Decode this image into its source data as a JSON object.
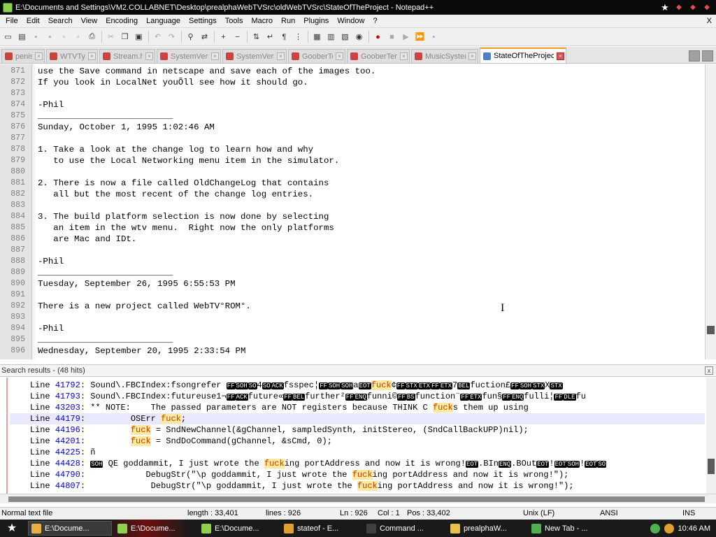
{
  "window": {
    "title": "E:\\Documents and Settings\\VM2.COLLABNET\\Desktop\\prealphaWebTVSrc\\oldWebTVSrc\\StateOfTheProject - Notepad++"
  },
  "menu": [
    "File",
    "Edit",
    "Search",
    "View",
    "Encoding",
    "Language",
    "Settings",
    "Tools",
    "Macro",
    "Run",
    "Plugins",
    "Window",
    "?"
  ],
  "menu_close": "X",
  "tabs": [
    {
      "label": "penis",
      "active": false
    },
    {
      "label": "WTVTypes.h",
      "active": false
    },
    {
      "label": "Stream.h",
      "active": false
    },
    {
      "label": "SystemVersion.h",
      "active": false
    },
    {
      "label": "SystemVersion.c",
      "active": false
    },
    {
      "label": "GooberTerm",
      "active": false
    },
    {
      "label": "GooberTerm",
      "active": false
    },
    {
      "label": "MusicSystem.c",
      "active": false
    },
    {
      "label": "StateOfTheProject",
      "active": true
    }
  ],
  "editor": {
    "lines": [
      {
        "n": "871",
        "t": "use the Save command in netscape and save each of the images too."
      },
      {
        "n": "872",
        "t": "If you look in LocalNet youÕll see how it should go."
      },
      {
        "n": "873",
        "t": ""
      },
      {
        "n": "874",
        "t": "-Phil"
      },
      {
        "n": "875",
        "t": "__________________________"
      },
      {
        "n": "876",
        "t": "Sunday, October 1, 1995 1:02:46 AM"
      },
      {
        "n": "877",
        "t": ""
      },
      {
        "n": "878",
        "t": "1. Take a look at the change log to learn how and why"
      },
      {
        "n": "879",
        "t": "   to use the Local Networking menu item in the simulator."
      },
      {
        "n": "880",
        "t": ""
      },
      {
        "n": "881",
        "t": "2. There is now a file called OldChangeLog that contains"
      },
      {
        "n": "882",
        "t": "   all but the most recent of the change log entries."
      },
      {
        "n": "883",
        "t": ""
      },
      {
        "n": "884",
        "t": "3. The build platform selection is now done by selecting"
      },
      {
        "n": "885",
        "t": "   an item in the wtv menu.  Right now the only platforms"
      },
      {
        "n": "886",
        "t": "   are Mac and IDt."
      },
      {
        "n": "887",
        "t": ""
      },
      {
        "n": "888",
        "t": "-Phil"
      },
      {
        "n": "889",
        "t": "__________________________"
      },
      {
        "n": "890",
        "t": "Tuesday, September 26, 1995 6:55:53 PM"
      },
      {
        "n": "891",
        "t": ""
      },
      {
        "n": "892",
        "t": "There is a new project called WebTV°ROM°."
      },
      {
        "n": "893",
        "t": ""
      },
      {
        "n": "894",
        "t": "-Phil"
      },
      {
        "n": "895",
        "t": "__________________________"
      },
      {
        "n": "896",
        "t": "Wednesday, September 20, 1995 2:33:54 PM"
      }
    ]
  },
  "search": {
    "header": "Search results - (48 hits)",
    "close": "x",
    "rows": [
      {
        "label": "Line ",
        "num": "41792",
        "pre": ": Sound\\.FBCIndex:fsongrefer ",
        "rest": [
          [
            "c",
            "FF"
          ],
          [
            "c",
            "SOH"
          ],
          [
            "c",
            "SO"
          ],
          [
            "t",
            "4"
          ],
          [
            "c",
            "SO"
          ],
          [
            "c",
            "ACK"
          ],
          [
            "t",
            "fsspec¦"
          ],
          [
            "c",
            "FF"
          ],
          [
            "c",
            "SOH"
          ],
          [
            "c",
            "SOH"
          ],
          [
            "t",
            "a"
          ],
          [
            "c",
            "EOT"
          ],
          [
            "h",
            "fuck"
          ],
          [
            "t",
            "¢"
          ],
          [
            "c",
            "FF"
          ],
          [
            "c",
            "STX"
          ],
          [
            "c",
            "ETX"
          ],
          [
            "c",
            "FF"
          ],
          [
            "c",
            "ETX"
          ],
          [
            "t",
            "7"
          ],
          [
            "c",
            "BEL"
          ],
          [
            "t",
            "fuction£"
          ],
          [
            "c",
            "FF"
          ],
          [
            "c",
            "SOH"
          ],
          [
            "c",
            "STX"
          ],
          [
            "t",
            "X"
          ],
          [
            "c",
            "STX"
          ]
        ],
        "sel": false
      },
      {
        "label": "Line ",
        "num": "41793",
        "pre": ": Sound\\.FBCIndex:futureuse1¬",
        "rest": [
          [
            "c",
            "FF"
          ],
          [
            "c",
            "ACK"
          ],
          [
            "t",
            "future«"
          ],
          [
            "c",
            "FF"
          ],
          [
            "c",
            "BEL"
          ],
          [
            "t",
            "further²"
          ],
          [
            "c",
            "FF"
          ],
          [
            "c",
            "ENQ"
          ],
          [
            "t",
            "funni©"
          ],
          [
            "c",
            "FF"
          ],
          [
            "c",
            "BS"
          ],
          [
            "t",
            "function¨"
          ],
          [
            "c",
            "FF"
          ],
          [
            "c",
            "ETX"
          ],
          [
            "t",
            "fun§"
          ],
          [
            "c",
            "FF"
          ],
          [
            "c",
            "ENQ"
          ],
          [
            "t",
            "fulli¦"
          ],
          [
            "c",
            "FF"
          ],
          [
            "c",
            "DLE"
          ],
          [
            "t",
            "fu"
          ]
        ],
        "sel": false
      },
      {
        "label": "Line ",
        "num": "43203",
        "pre": ": ** NOTE:    The passed parameters are NOT registers because THINK C ",
        "rest": [
          [
            "h",
            "fuck"
          ],
          [
            "t",
            "s them up using"
          ]
        ],
        "sel": false
      },
      {
        "label": "Line ",
        "num": "44179",
        "pre": ":         OSErr ",
        "rest": [
          [
            "h",
            "fuck"
          ],
          [
            "t",
            ";"
          ]
        ],
        "sel": true
      },
      {
        "label": "Line ",
        "num": "44196",
        "pre": ":         ",
        "rest": [
          [
            "h",
            "fuck"
          ],
          [
            "t",
            " = SndNewChannel(&gChannel, sampledSynth, initStereo, (SndCallBackUPP)nil);"
          ]
        ],
        "sel": false
      },
      {
        "label": "Line ",
        "num": "44201",
        "pre": ":         ",
        "rest": [
          [
            "h",
            "fuck"
          ],
          [
            "t",
            " = SndDoCommand(gChannel, &sCmd, 0);"
          ]
        ],
        "sel": false
      },
      {
        "label": "Line ",
        "num": "44225",
        "pre": ": ñ",
        "rest": [],
        "sel": false
      },
      {
        "label": "Line ",
        "num": "44428",
        "pre": ": ",
        "rest": [
          [
            "c",
            "SOH"
          ],
          [
            "t",
            " QE goddammit, I just wrote the "
          ],
          [
            "h",
            "fuck"
          ],
          [
            "t",
            "ing portAddress and now it is wrong!"
          ],
          [
            "c",
            "EOT"
          ],
          [
            "t",
            ".BIn"
          ],
          [
            "c",
            "ENQ"
          ],
          [
            "t",
            ".BOut"
          ],
          [
            "c",
            "EOT"
          ],
          [
            "t",
            "!"
          ],
          [
            "c",
            "EOT"
          ],
          [
            "c",
            "SOH"
          ],
          [
            "t",
            "!"
          ],
          [
            "c",
            "EOT"
          ],
          [
            "c",
            "SO"
          ]
        ],
        "sel": false
      },
      {
        "label": "Line ",
        "num": "44790",
        "pre": ":            DebugStr(\"\\p goddammit, I just wrote the ",
        "rest": [
          [
            "h",
            "fuck"
          ],
          [
            "t",
            "ing portAddress and now it is wrong!\");"
          ]
        ],
        "sel": false
      },
      {
        "label": "Line ",
        "num": "44807",
        "pre": ":             DebugStr(\"\\p goddammit, I just wrote the ",
        "rest": [
          [
            "h",
            "fuck"
          ],
          [
            "t",
            "ing portAddress and now it is wrong!\");"
          ]
        ],
        "sel": false
      }
    ]
  },
  "status": {
    "type": "Normal text file",
    "length": "length : 33,401",
    "lines": "lines : 926",
    "ln": "Ln : 926",
    "col": "Col : 1",
    "pos": "Pos : 33,402",
    "eol": "Unix (LF)",
    "enc": "ANSI",
    "ins": "INS"
  },
  "taskbar": {
    "items": [
      {
        "label": "E:\\Docume...",
        "active": true,
        "color": "#e8b040"
      },
      {
        "label": "E:\\Docume...",
        "active": false,
        "color": "#8fd14f"
      },
      {
        "label": "E:\\Docume...",
        "active": false,
        "color": "#8fd14f"
      },
      {
        "label": "stateof - E...",
        "active": false,
        "color": "#e0a030"
      },
      {
        "label": "Command ...",
        "active": false,
        "color": "#404040"
      },
      {
        "label": "prealphaW...",
        "active": false,
        "color": "#e8c050"
      },
      {
        "label": "New Tab - ...",
        "active": false,
        "color": "#50b050"
      }
    ],
    "clock": "10:46 AM"
  },
  "colors": {
    "accent_tab": "#f0a030",
    "highlight": "#ffe8a0",
    "linenum": "#0000e0"
  }
}
